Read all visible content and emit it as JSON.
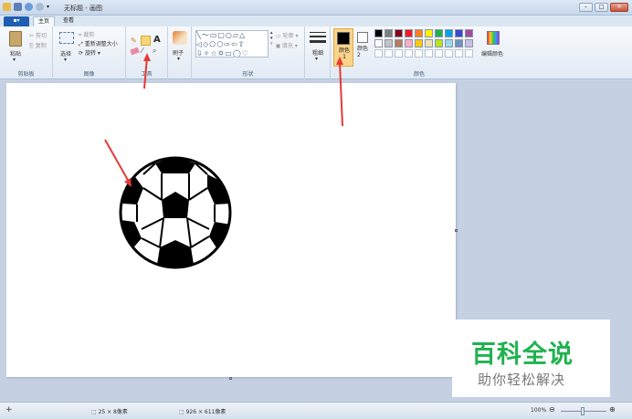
{
  "window": {
    "title": "无标题 - 画图"
  },
  "tabs": [
    {
      "label": "主页"
    },
    {
      "label": "查看"
    }
  ],
  "clipboard": {
    "paste": "粘贴",
    "cut": "剪切",
    "copy": "复制",
    "group": "剪贴板"
  },
  "image": {
    "select": "选择",
    "crop": "裁剪",
    "resize": "重新调整大小",
    "rotate": "旋转",
    "group": "图像"
  },
  "tools": {
    "group": "工具",
    "text_icon": "A"
  },
  "brushes": {
    "label": "刷子"
  },
  "shapes": {
    "outline": "轮廓",
    "fill": "填充",
    "group": "形状"
  },
  "size": {
    "label": "粗细"
  },
  "colors": {
    "color1": "颜色 1",
    "color2": "颜色 2",
    "edit": "编辑颜色",
    "group": "颜色",
    "palette_row1": [
      "#000000",
      "#7f7f7f",
      "#880015",
      "#ed1c24",
      "#ff7f27",
      "#fff200",
      "#22b14c",
      "#00a2e8",
      "#3f48cc",
      "#a349a4"
    ],
    "palette_row2": [
      "#ffffff",
      "#c3c3c3",
      "#b97a57",
      "#ffaec9",
      "#ffc90e",
      "#efe4b0",
      "#b5e61d",
      "#99d9ea",
      "#7092be",
      "#c8bfe7"
    ]
  },
  "status": {
    "selection": "25 × 8像素",
    "canvas_size": "926 × 611像素",
    "zoom": "100%"
  },
  "watermark": {
    "title": "百科全说",
    "subtitle": "助你轻松解决"
  }
}
